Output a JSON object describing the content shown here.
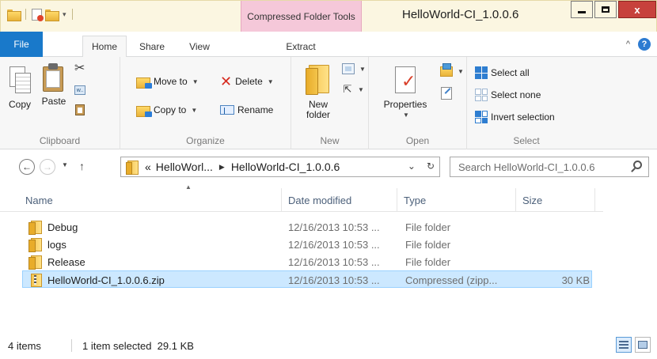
{
  "window": {
    "title": "HelloWorld-CI_1.0.0.6",
    "context_tab_group": "Compressed Folder Tools",
    "close_label": "x"
  },
  "tabs": {
    "file": "File",
    "home": "Home",
    "share": "Share",
    "view": "View",
    "extract": "Extract",
    "help": "?"
  },
  "ribbon": {
    "clipboard": {
      "label": "Clipboard",
      "copy": "Copy",
      "paste": "Paste"
    },
    "organize": {
      "label": "Organize",
      "move_to": "Move to",
      "copy_to": "Copy to",
      "delete": "Delete",
      "rename": "Rename"
    },
    "new": {
      "label": "New",
      "new_folder_line1": "New",
      "new_folder_line2": "folder"
    },
    "open": {
      "label": "Open",
      "properties": "Properties"
    },
    "select": {
      "label": "Select",
      "select_all": "Select all",
      "select_none": "Select none",
      "invert_selection": "Invert selection"
    }
  },
  "address": {
    "overflow": "«",
    "crumbs": [
      "HelloWorl...",
      "HelloWorld-CI_1.0.0.6"
    ],
    "search_placeholder": "Search HelloWorld-CI_1.0.0.6"
  },
  "columns": {
    "name": "Name",
    "date": "Date modified",
    "type": "Type",
    "size": "Size"
  },
  "files": [
    {
      "name": "Debug",
      "date": "12/16/2013 10:53 ...",
      "type": "File folder",
      "size": "",
      "icon": "folder-icon",
      "selected": false
    },
    {
      "name": "logs",
      "date": "12/16/2013 10:53 ...",
      "type": "File folder",
      "size": "",
      "icon": "folder-icon",
      "selected": false
    },
    {
      "name": "Release",
      "date": "12/16/2013 10:53 ...",
      "type": "File folder",
      "size": "",
      "icon": "folder-icon",
      "selected": false
    },
    {
      "name": "HelloWorld-CI_1.0.0.6.zip",
      "date": "12/16/2013 10:53 ...",
      "type": "Compressed (zipp...",
      "size": "30 KB",
      "icon": "zip-folder-icon",
      "selected": true
    }
  ],
  "status": {
    "item_count": "4 items",
    "selection": "1 item selected  29.1 KB"
  },
  "colors": {
    "title_bar": "#fbf6e1",
    "context_tab": "#f5c8d9",
    "file_tab": "#1979ca",
    "selection": "#cce8ff",
    "close_button": "#c7413c"
  }
}
